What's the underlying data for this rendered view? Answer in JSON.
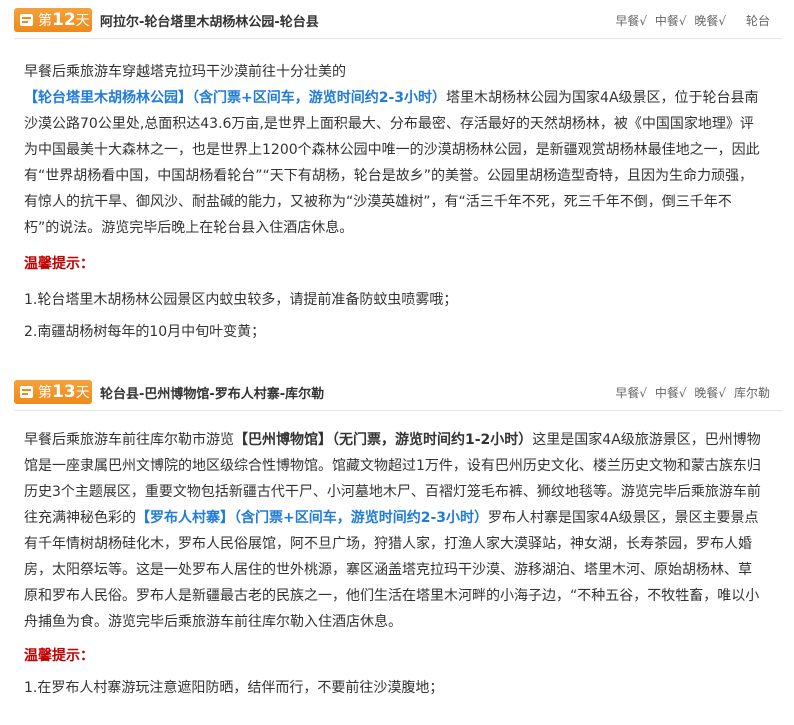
{
  "days": [
    {
      "badge_prefix": "第",
      "badge_num": "12",
      "badge_suffix": "天",
      "route": "阿拉尔-轮台塔里木胡杨林公园-轮台县",
      "meals": [
        "早餐√",
        "中餐√",
        "晚餐√"
      ],
      "stay": "轮台",
      "body": [
        {
          "t": "早餐后乘旅游车穿越塔克拉玛干沙漠前往十分壮美的",
          "hl": false
        },
        {
          "t": "【轮台塔里木胡杨林公园】（含门票+区间车，游览时间约2-3小时）",
          "hl": true
        },
        {
          "t": "塔里木胡杨林公园为国家4A级景区，位于轮台县南沙漠公路70公里处,总面积达43.6万亩,是世界上面积最大、分布最密、存活最好的天然胡杨林，被《中国国家地理》评为中国最美十大森林之一，也是世界上1200个森林公园中唯一的沙漠胡杨林公园，是新疆观赏胡杨林最佳地之一，因此有“世界胡杨看中国，中国胡杨看轮台”“天下有胡杨，轮台是故乡”的美誉。公园里胡杨造型奇特，且因为生命力顽强，有惊人的抗干旱、御风沙、耐盐碱的能力，又被称为“沙漠英雄树”，有“活三千年不死，死三千年不倒，倒三千年不朽”的说法。游览完毕后晚上在轮台县入住酒店休息。",
          "hl": false
        }
      ],
      "tip_title": "温馨提示：",
      "tips": [
        "1.轮台塔里木胡杨林公园景区内蚊虫较多，请提前准备防蚊虫喷雾哦；",
        "2.南疆胡杨树每年的10月中旬叶变黄；"
      ]
    },
    {
      "badge_prefix": "第",
      "badge_num": "13",
      "badge_suffix": "天",
      "route": "轮台县-巴州博物馆-罗布人村寨-库尔勒",
      "meals": [
        "早餐√",
        "中餐√",
        "晚餐√"
      ],
      "stay": "库尔勒",
      "body": [
        {
          "t": "早餐后乘旅游车前往库尔勒市游览",
          "hl": false
        },
        {
          "t": "【巴州博物馆】（无门票，游览时间约1-2小时）",
          "hl": "dark"
        },
        {
          "t": "这里是国家4A级旅游景区，巴州博物馆是一座隶属巴州文博院的地区级综合性博物馆。馆藏文物超过1万件，设有巴州历史文化、楼兰历史文物和蒙古族东归历史3个主题展区，重要文物包括新疆古代干尸、小河墓地木尸、百褶灯笼毛布裤、狮纹地毯等。游览完毕后乘旅游车前往充满神秘色彩的",
          "hl": false
        },
        {
          "t": "【罗布人村寨】（含门票+区间车，游览时间约2-3小时）",
          "hl": true
        },
        {
          "t": "罗布人村寨是国家4A级景区，景区主要景点有千年情树胡杨硅化木，罗布人民俗展馆，阿不旦广场，狩猎人家，打渔人家大漠驿站，神女湖，长寿茶园，罗布人婚房，太阳祭坛等。这是一处罗布人居住的世外桃源，寨区涵盖塔克拉玛干沙漠、游移湖泊、塔里木河、原始胡杨林、草原和罗布人民俗。罗布人是新疆最古老的民族之一，他们生活在塔里木河畔的小海子边，“不种五谷，不牧牲畜，唯以小舟捕鱼为食。游览完毕后乘旅游车前往库尔勒入住酒店休息。",
          "hl": false
        }
      ],
      "tip_title": "温馨提示：",
      "tips": [
        "1.在罗布人村寨游玩注意遮阳防晒，结伴而行，不要前往沙漠腹地；"
      ]
    }
  ]
}
